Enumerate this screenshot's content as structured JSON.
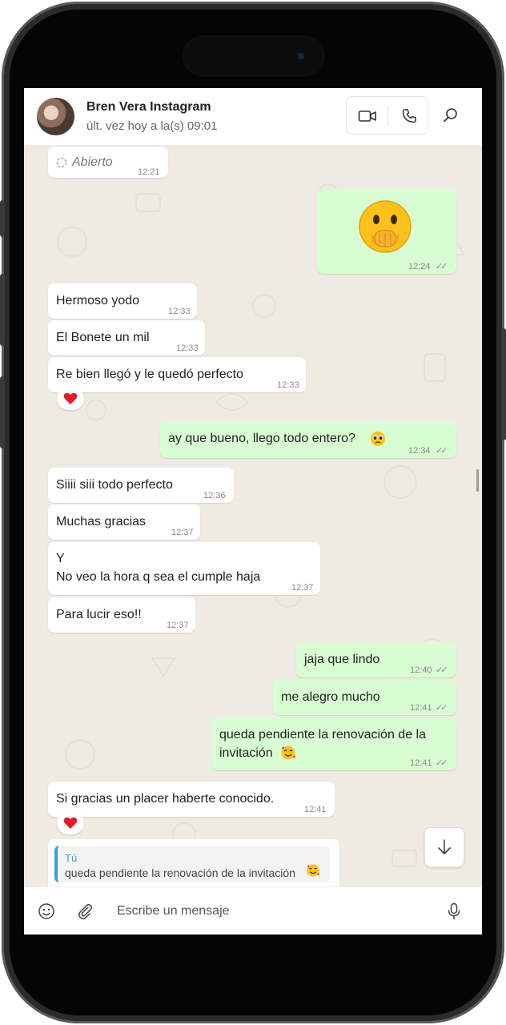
{
  "header": {
    "contact_name": "Bren Vera Instagram",
    "contact_status": "últ. vez hoy a la(s) 09:01"
  },
  "messages": [
    {
      "dir": "in",
      "kind": "status",
      "text": "Abierto",
      "time": "12:21"
    },
    {
      "dir": "out",
      "kind": "emoji",
      "emoji": "face-with-hand-over-mouth",
      "time": "12:24"
    },
    {
      "dir": "in",
      "text": "Hermoso yodo",
      "time": "12:33"
    },
    {
      "dir": "in",
      "text": "El Bonete un mil",
      "time": "12:33"
    },
    {
      "dir": "in",
      "text": "Re bien llegó y le quedó perfecto",
      "time": "12:33",
      "reaction": "❤️"
    },
    {
      "dir": "out",
      "text": "ay que bueno, llego todo entero?",
      "emoji": "pleading-face",
      "time": "12:34"
    },
    {
      "dir": "in",
      "text": "Siiii siii todo perfecto",
      "time": "12:36"
    },
    {
      "dir": "in",
      "text": "Muchas gracias",
      "time": "12:37"
    },
    {
      "dir": "in",
      "lines": [
        "Y",
        "No veo la hora q sea el cumple haja"
      ],
      "time": "12:37"
    },
    {
      "dir": "in",
      "text": "Para lucir eso!!",
      "time": "12:37"
    },
    {
      "dir": "out",
      "text": "jaja que lindo",
      "time": "12:40"
    },
    {
      "dir": "out",
      "text": "me alegro mucho",
      "time": "12:41"
    },
    {
      "dir": "out",
      "lines": [
        "queda pendiente la renovación de la",
        "invitación"
      ],
      "emoji": "smiling-face-with-hearts",
      "time": "12:41"
    },
    {
      "dir": "in",
      "text": "Si gracias un placer haberte conocido.",
      "time": "12:41",
      "reaction": "❤️"
    },
    {
      "dir": "in",
      "kind": "reply",
      "quote_author": "Tú",
      "quote_text": "queda pendiente la renovación de la invitación",
      "quote_emoji": "smiling-face-with-hearts"
    }
  ],
  "composer": {
    "placeholder": "Escribe un mensaje"
  },
  "colors": {
    "outgoing_bubble": "#d9fdd3",
    "incoming_bubble": "#ffffff",
    "chat_background": "#efeae2",
    "quote_accent": "#35a0dc"
  }
}
